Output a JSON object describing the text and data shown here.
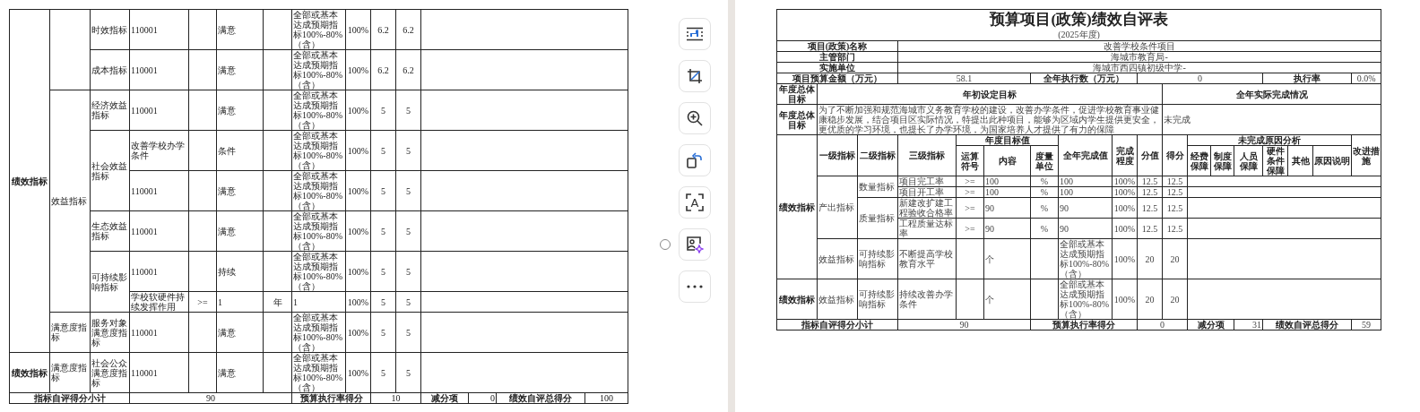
{
  "left_sheet": {
    "rows": [
      [
        {
          "kind": "head",
          "text": "绩效指标",
          "rowspan": 9
        },
        {
          "kind": "blank",
          "rowspan": 2
        },
        {
          "kind": "text",
          "text": "时效指标"
        },
        {
          "kind": "text",
          "text": "110001"
        },
        {
          "kind": "blank"
        },
        {
          "kind": "text",
          "text": "满意"
        },
        {
          "kind": "blank"
        },
        {
          "kind": "text",
          "text": "全部或基本达成预期指标100%-80%（含）"
        },
        {
          "kind": "num",
          "text": "100%"
        },
        {
          "kind": "num",
          "text": "6.2"
        },
        {
          "kind": "num",
          "text": "6.2"
        },
        {
          "kind": "blank",
          "colspan": 7
        }
      ],
      [
        {
          "kind": "text",
          "text": "成本指标"
        },
        {
          "kind": "text",
          "text": "110001"
        },
        {
          "kind": "blank"
        },
        {
          "kind": "text",
          "text": "满意"
        },
        {
          "kind": "blank"
        },
        {
          "kind": "text",
          "text": "全部或基本达成预期指标100%-80%（含）"
        },
        {
          "kind": "num",
          "text": "100%"
        },
        {
          "kind": "num",
          "text": "6.2"
        },
        {
          "kind": "num",
          "text": "6.2"
        },
        {
          "kind": "blank",
          "colspan": 7
        }
      ],
      [
        {
          "kind": "text",
          "text": "效益指标",
          "rowspan": 6
        },
        {
          "kind": "text",
          "text": "经济效益指标"
        },
        {
          "kind": "text",
          "text": "110001"
        },
        {
          "kind": "blank"
        },
        {
          "kind": "text",
          "text": "满意"
        },
        {
          "kind": "blank"
        },
        {
          "kind": "text",
          "text": "全部或基本达成预期指标100%-80%（含）"
        },
        {
          "kind": "num",
          "text": "100%"
        },
        {
          "kind": "num",
          "text": "5"
        },
        {
          "kind": "num",
          "text": "5"
        },
        {
          "kind": "blank",
          "colspan": 7
        }
      ],
      [
        {
          "kind": "text",
          "text": "社会效益指标",
          "rowspan": 2
        },
        {
          "kind": "text",
          "text": "改善学校办学条件"
        },
        {
          "kind": "blank"
        },
        {
          "kind": "text",
          "text": "条件"
        },
        {
          "kind": "blank"
        },
        {
          "kind": "text",
          "text": "全部或基本达成预期指标100%-80%（含）"
        },
        {
          "kind": "num",
          "text": "100%"
        },
        {
          "kind": "num",
          "text": "5"
        },
        {
          "kind": "num",
          "text": "5"
        },
        {
          "kind": "blank",
          "colspan": 7
        }
      ],
      [
        {
          "kind": "text",
          "text": "110001"
        },
        {
          "kind": "blank"
        },
        {
          "kind": "text",
          "text": "满意"
        },
        {
          "kind": "blank"
        },
        {
          "kind": "text",
          "text": "全部或基本达成预期指标100%-80%（含）"
        },
        {
          "kind": "num",
          "text": "100%"
        },
        {
          "kind": "num",
          "text": "5"
        },
        {
          "kind": "num",
          "text": "5"
        },
        {
          "kind": "blank",
          "colspan": 7
        }
      ],
      [
        {
          "kind": "text",
          "text": "生态效益指标"
        },
        {
          "kind": "text",
          "text": "110001"
        },
        {
          "kind": "blank"
        },
        {
          "kind": "text",
          "text": "满意"
        },
        {
          "kind": "blank"
        },
        {
          "kind": "text",
          "text": "全部或基本达成预期指标100%-80%（含）"
        },
        {
          "kind": "num",
          "text": "100%"
        },
        {
          "kind": "num",
          "text": "5"
        },
        {
          "kind": "num",
          "text": "5"
        },
        {
          "kind": "blank",
          "colspan": 7
        }
      ],
      [
        {
          "kind": "text",
          "text": "可持续影响指标",
          "rowspan": 2
        },
        {
          "kind": "text",
          "text": "110001"
        },
        {
          "kind": "blank"
        },
        {
          "kind": "text",
          "text": "持续"
        },
        {
          "kind": "blank"
        },
        {
          "kind": "text",
          "text": "全部或基本达成预期指标100%-80%（含）"
        },
        {
          "kind": "num",
          "text": "100%"
        },
        {
          "kind": "num",
          "text": "5"
        },
        {
          "kind": "num",
          "text": "5"
        },
        {
          "kind": "blank",
          "colspan": 7
        }
      ],
      [
        {
          "kind": "text",
          "text": "学校软硬件持续发挥作用"
        },
        {
          "kind": "num",
          "text": ">="
        },
        {
          "kind": "text",
          "text": "1"
        },
        {
          "kind": "num",
          "text": "年"
        },
        {
          "kind": "text",
          "text": "1"
        },
        {
          "kind": "num",
          "text": "100%"
        },
        {
          "kind": "num",
          "text": "5"
        },
        {
          "kind": "num",
          "text": "5"
        },
        {
          "kind": "blank",
          "colspan": 7
        }
      ],
      [
        {
          "kind": "text",
          "text": "满意度指标"
        },
        {
          "kind": "text",
          "text": "服务对象满意度指标"
        },
        {
          "kind": "text",
          "text": "110001"
        },
        {
          "kind": "blank"
        },
        {
          "kind": "text",
          "text": "满意"
        },
        {
          "kind": "blank"
        },
        {
          "kind": "text",
          "text": "全部或基本达成预期指标100%-80%（含）"
        },
        {
          "kind": "num",
          "text": "100%"
        },
        {
          "kind": "num",
          "text": "5"
        },
        {
          "kind": "num",
          "text": "5"
        },
        {
          "kind": "blank",
          "colspan": 7
        }
      ],
      [
        {
          "kind": "head",
          "text": "绩效指标"
        },
        {
          "kind": "text",
          "text": "满意度指标"
        },
        {
          "kind": "text",
          "text": "社会公众满意度指标"
        },
        {
          "kind": "text",
          "text": "110001"
        },
        {
          "kind": "blank"
        },
        {
          "kind": "text",
          "text": "满意"
        },
        {
          "kind": "blank"
        },
        {
          "kind": "text",
          "text": "全部或基本达成预期指标100%-80%（含）"
        },
        {
          "kind": "num",
          "text": "100%"
        },
        {
          "kind": "num",
          "text": "5"
        },
        {
          "kind": "num",
          "text": "5"
        },
        {
          "kind": "blank",
          "colspan": 7
        }
      ],
      [
        {
          "kind": "head",
          "text": "指标自评得分小计",
          "colspan": 3
        },
        {
          "kind": "num",
          "text": "90",
          "colspan": 4
        },
        {
          "kind": "head",
          "text": "预算执行率得分",
          "colspan": 2
        },
        {
          "kind": "num",
          "text": "10",
          "colspan": 2
        },
        {
          "kind": "head",
          "text": "减分项",
          "colspan": 2
        },
        {
          "kind": "right",
          "text": "0"
        },
        {
          "kind": "head",
          "text": "绩效自评总得分",
          "colspan": 3
        },
        {
          "kind": "num",
          "text": "100"
        }
      ]
    ]
  },
  "toolbar": [
    {
      "kind": "wrap"
    },
    {
      "kind": "crop"
    },
    {
      "kind": "zoom"
    },
    {
      "kind": "rotate"
    },
    {
      "kind": "text_scan",
      "glyph": "A"
    },
    {
      "kind": "image_ai"
    },
    {
      "kind": "more"
    }
  ],
  "select_marker": {
    "checked": false
  },
  "right_sheet": {
    "title": "预算项目(政策)绩效自评表",
    "subtitle": "(2025年度)",
    "rows": [
      [
        {
          "kind": "head",
          "text": "项目(政策)名称",
          "colspan": 3
        },
        {
          "kind": "num",
          "text": "改善学校条件项目",
          "colspan": 15
        }
      ],
      [
        {
          "kind": "head",
          "text": "主管部门",
          "colspan": 3
        },
        {
          "kind": "num",
          "text": "海城市教育局-",
          "colspan": 15
        }
      ],
      [
        {
          "kind": "head",
          "text": "实施单位",
          "colspan": 3
        },
        {
          "kind": "num",
          "text": "海城市西四镇初级中学-",
          "colspan": 15
        }
      ],
      [
        {
          "kind": "head",
          "text": "项目预算金额（万元）",
          "colspan": 3
        },
        {
          "kind": "num",
          "text": "58.1",
          "colspan": 3
        },
        {
          "kind": "head",
          "text": "全年执行数（万元）",
          "colspan": 3
        },
        {
          "kind": "num",
          "text": "0",
          "colspan": 5
        },
        {
          "kind": "head",
          "text": "执行率",
          "colspan": 3
        },
        {
          "kind": "num",
          "text": "0.0%"
        }
      ],
      [
        {
          "kind": "head",
          "text": "年度总体目标"
        },
        {
          "kind": "head",
          "text": "年初设定目标",
          "colspan": 9
        },
        {
          "kind": "head",
          "text": "全年实际完成情况",
          "colspan": 8
        }
      ],
      [
        {
          "kind": "head",
          "text": "年度总体目标"
        },
        {
          "kind": "text",
          "text": "为了不断加强和规范海城市义务教育学校的建设，改善办学条件，促进学校教育事业健康稳步发展，结合项目区实际情况，特提出此种项目，能够为区域内学生提供更安全，更优质的学习环境，也提长了办学环境，为国家培养人才提供了有力的保障",
          "colspan": 9
        },
        {
          "kind": "text",
          "text": "未完成",
          "colspan": 8
        }
      ],
      [
        {
          "kind": "head",
          "text": "绩效指标",
          "rowspan": 7
        },
        {
          "kind": "head",
          "text": "一级指标",
          "rowspan": 2
        },
        {
          "kind": "head",
          "text": "二级指标",
          "rowspan": 2
        },
        {
          "kind": "head",
          "text": "三级指标",
          "rowspan": 2
        },
        {
          "kind": "head",
          "text": "年度目标值",
          "colspan": 3
        },
        {
          "kind": "head",
          "text": "全年完成值",
          "rowspan": 2
        },
        {
          "kind": "head",
          "text": "完成程度",
          "rowspan": 2
        },
        {
          "kind": "head",
          "text": "分值",
          "rowspan": 2
        },
        {
          "kind": "head",
          "text": "得分",
          "rowspan": 2
        },
        {
          "kind": "head",
          "text": "未完成原因分析",
          "colspan": 6
        },
        {
          "kind": "head",
          "text": "改进措施",
          "rowspan": 2
        }
      ],
      [
        {
          "kind": "head",
          "text": "运算符号"
        },
        {
          "kind": "head",
          "text": "内容"
        },
        {
          "kind": "head",
          "text": "度量单位"
        },
        {
          "kind": "head",
          "text": "经费保障"
        },
        {
          "kind": "head",
          "text": "制度保障"
        },
        {
          "kind": "head",
          "text": "人员保障"
        },
        {
          "kind": "head",
          "text": "硬件条件保障"
        },
        {
          "kind": "head",
          "text": "其他"
        },
        {
          "kind": "head",
          "text": "原因说明"
        }
      ],
      [
        {
          "kind": "text",
          "text": "产出指标",
          "rowspan": 4
        },
        {
          "kind": "text",
          "text": "数量指标",
          "rowspan": 2
        },
        {
          "kind": "text",
          "text": "项目完工率"
        },
        {
          "kind": "num",
          "text": ">="
        },
        {
          "kind": "text",
          "text": "100"
        },
        {
          "kind": "num",
          "text": "%"
        },
        {
          "kind": "text",
          "text": "100"
        },
        {
          "kind": "num",
          "text": "100%"
        },
        {
          "kind": "num",
          "text": "12.5"
        },
        {
          "kind": "num",
          "text": "12.5"
        },
        {
          "kind": "blank",
          "colspan": 7
        }
      ],
      [
        {
          "kind": "text",
          "text": "项目开工率"
        },
        {
          "kind": "num",
          "text": ">="
        },
        {
          "kind": "text",
          "text": "100"
        },
        {
          "kind": "num",
          "text": "%"
        },
        {
          "kind": "text",
          "text": "100"
        },
        {
          "kind": "num",
          "text": "100%"
        },
        {
          "kind": "num",
          "text": "12.5"
        },
        {
          "kind": "num",
          "text": "12.5"
        },
        {
          "kind": "blank",
          "colspan": 7
        }
      ],
      [
        {
          "kind": "text",
          "text": "质量指标",
          "rowspan": 2
        },
        {
          "kind": "text",
          "text": "新建改扩建工程验收合格率"
        },
        {
          "kind": "num",
          "text": ">="
        },
        {
          "kind": "text",
          "text": "90"
        },
        {
          "kind": "num",
          "text": "%"
        },
        {
          "kind": "text",
          "text": "90"
        },
        {
          "kind": "num",
          "text": "100%"
        },
        {
          "kind": "num",
          "text": "12.5"
        },
        {
          "kind": "num",
          "text": "12.5"
        },
        {
          "kind": "blank",
          "colspan": 7
        }
      ],
      [
        {
          "kind": "text",
          "text": "工程质量达标率"
        },
        {
          "kind": "num",
          "text": ">="
        },
        {
          "kind": "text",
          "text": "90"
        },
        {
          "kind": "num",
          "text": "%"
        },
        {
          "kind": "text",
          "text": "90"
        },
        {
          "kind": "num",
          "text": "100%"
        },
        {
          "kind": "num",
          "text": "12.5"
        },
        {
          "kind": "num",
          "text": "12.5"
        },
        {
          "kind": "blank",
          "colspan": 7
        }
      ],
      [
        {
          "kind": "text",
          "text": "效益指标"
        },
        {
          "kind": "text",
          "text": "可持续影响指标"
        },
        {
          "kind": "text",
          "text": "不断提高学校教育水平"
        },
        {
          "kind": "blank"
        },
        {
          "kind": "text",
          "text": "个"
        },
        {
          "kind": "blank"
        },
        {
          "kind": "text",
          "text": "全部或基本达成预期指标100%-80%（含）"
        },
        {
          "kind": "num",
          "text": "100%"
        },
        {
          "kind": "num",
          "text": "20"
        },
        {
          "kind": "num",
          "text": "20"
        },
        {
          "kind": "blank",
          "colspan": 7
        }
      ],
      [
        {
          "kind": "head",
          "text": "绩效指标"
        },
        {
          "kind": "text",
          "text": "效益指标"
        },
        {
          "kind": "text",
          "text": "可持续影响指标"
        },
        {
          "kind": "text",
          "text": "持续改善办学条件"
        },
        {
          "kind": "blank"
        },
        {
          "kind": "text",
          "text": "个"
        },
        {
          "kind": "blank"
        },
        {
          "kind": "text",
          "text": "全部或基本达成预期指标100%-80%（含）"
        },
        {
          "kind": "num",
          "text": "100%"
        },
        {
          "kind": "num",
          "text": "20"
        },
        {
          "kind": "num",
          "text": "20"
        },
        {
          "kind": "blank",
          "colspan": 7
        }
      ],
      [
        {
          "kind": "head",
          "text": "指标自评得分小计",
          "colspan": 3
        },
        {
          "kind": "num",
          "text": "90",
          "colspan": 3
        },
        {
          "kind": "head",
          "text": "预算执行率得分",
          "colspan": 3
        },
        {
          "kind": "num",
          "text": "0",
          "colspan": 2
        },
        {
          "kind": "head",
          "text": "减分项",
          "colspan": 2
        },
        {
          "kind": "right",
          "text": "31"
        },
        {
          "kind": "head",
          "text": "绩效自评总得分",
          "colspan": 3
        },
        {
          "kind": "num",
          "text": "59"
        }
      ]
    ]
  }
}
